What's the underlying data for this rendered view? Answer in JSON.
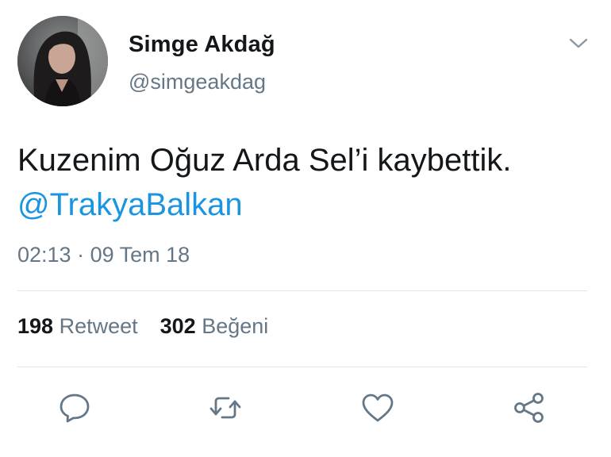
{
  "user": {
    "name": "Simge Akdağ",
    "handle": "@simgeakdag"
  },
  "tweet": {
    "text": "Kuzenim Oğuz Arda Sel’i kaybettik.",
    "mention": "@TrakyaBalkan",
    "time": "02:13",
    "separator": "·",
    "date": "09 Tem 18"
  },
  "stats": {
    "retweets_count": "198",
    "retweets_label": "Retweet",
    "likes_count": "302",
    "likes_label": "Beğeni"
  },
  "icons": {
    "menu": "chevron-down-icon",
    "reply": "reply-icon",
    "retweet": "retweet-icon",
    "like": "heart-icon",
    "share": "share-icon"
  },
  "colors": {
    "text": "#14171a",
    "secondary": "#657786",
    "link": "#1b95e0",
    "divider": "#e1e8ed"
  }
}
